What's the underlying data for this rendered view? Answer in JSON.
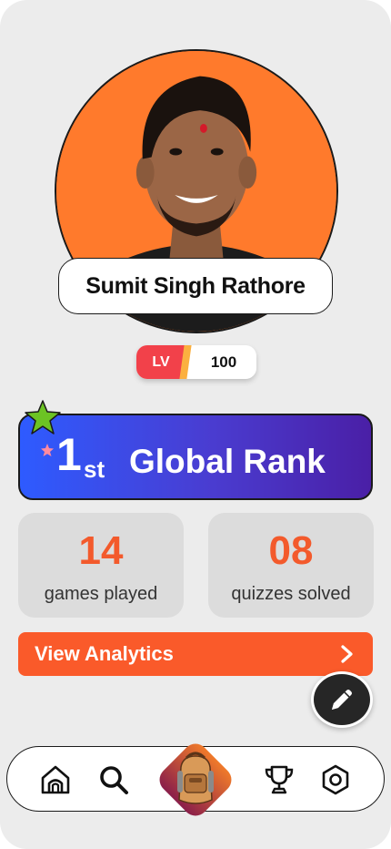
{
  "profile": {
    "name": "Sumit Singh Rathore",
    "level_label": "LV",
    "level_value": "100"
  },
  "rank": {
    "position": "1",
    "suffix": "st",
    "title": "Global Rank"
  },
  "stats": [
    {
      "value": "14",
      "label": "games played"
    },
    {
      "value": "08",
      "label": "quizzes solved"
    }
  ],
  "analytics": {
    "label": "View Analytics",
    "icon": "chevron-right-icon"
  },
  "fab": {
    "icon": "pencil-icon"
  },
  "nav": {
    "items": [
      {
        "icon": "home-icon"
      },
      {
        "icon": "search-icon"
      },
      {
        "icon": "backpack-icon"
      },
      {
        "icon": "trophy-icon"
      },
      {
        "icon": "settings-icon"
      }
    ]
  },
  "colors": {
    "background": "#ececec",
    "accent_orange": "#fa5a2a",
    "rank_gradient_start": "#2e5bff",
    "rank_gradient_end": "#4a1fa6",
    "level_red": "#f2414a"
  }
}
